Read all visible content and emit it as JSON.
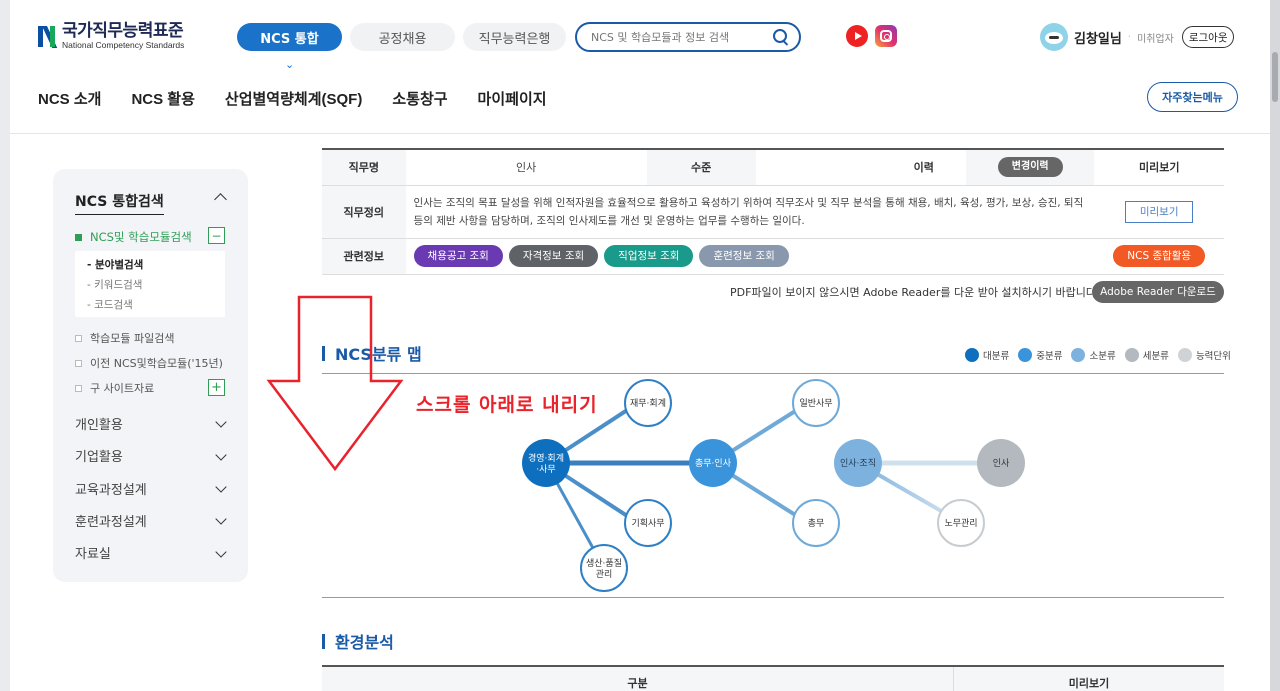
{
  "header": {
    "logo_ko": "국가직무능력표준",
    "logo_en": "National Competency Standards",
    "tabs": [
      "NCS 통합",
      "공정채용",
      "직무능력은행"
    ],
    "search_placeholder": "NCS 및 학습모듈과 정보 검색",
    "user_name": "김창일님",
    "user_role": "미취업자",
    "logout": "로그아웃",
    "nav": [
      "NCS 소개",
      "NCS 활용",
      "산업별역량체계(SQF)",
      "소통창구",
      "마이페이지"
    ],
    "faq": "자주찾는메뉴"
  },
  "sidebar": {
    "title": "NCS 통합검색",
    "active_item": "NCS및 학습모듈검색",
    "sub_items": [
      "- 분야별검색",
      "- 키워드검색",
      "- 코드검색"
    ],
    "items": [
      "학습모듈 파일검색",
      "이전 NCS및학습모듈('15년)",
      "구 사이트자료"
    ],
    "menus": [
      "개인활용",
      "기업활용",
      "교육과정설계",
      "훈련과정설계",
      "자료실"
    ]
  },
  "info": {
    "job_name_label": "직무명",
    "job_name": "인사",
    "level_label": "수준",
    "level": "",
    "history_label": "이력",
    "history_btn": "변경이력",
    "preview_label": "미리보기",
    "def_label": "직무정의",
    "definition": "인사는 조직의 목표 달성을 위해 인적자원을 효율적으로 활용하고 육성하기 위하여 직무조사 및 직무 분석을 통해 채용, 배치, 육성, 평가, 보상, 승진, 퇴직 등의 제반 사항을 담당하며, 조직의 인사제도를 개선 및 운영하는 업무를 수행하는 일이다.",
    "preview_btn": "미리보기",
    "related_label": "관련정보",
    "related_btns": [
      {
        "label": "채용공고 조회",
        "color": "#6a3ab2"
      },
      {
        "label": "자격정보 조회",
        "color": "#5f6368"
      },
      {
        "label": "직업정보 조회",
        "color": "#1a9a8a"
      },
      {
        "label": "훈련정보 조회",
        "color": "#8a98ad"
      }
    ],
    "ncs_btn": "NCS 종합활용"
  },
  "pdf_notice": "PDF파일이 보이지 않으시면 Adobe Reader를 다운 받아 설치하시기 바랍니다.",
  "pdf_btn": "Adobe Reader 다운로드",
  "map": {
    "title": "NCS분류 맵",
    "legend": [
      {
        "label": "대분류",
        "color": "#0f6fbf"
      },
      {
        "label": "중분류",
        "color": "#3a94dc"
      },
      {
        "label": "소분류",
        "color": "#7eb2de"
      },
      {
        "label": "세분류",
        "color": "#b3b9be"
      },
      {
        "label": "능력단위",
        "color": "#d0d3d6"
      }
    ],
    "nodes": {
      "root": "경영·회계·사무",
      "finance": "재무·회계",
      "planning": "기획사무",
      "production": "생산·품질관리",
      "general_hr": "총무·인사",
      "office": "일반사무",
      "general": "총무",
      "hr_org": "인사·조직",
      "hr": "인사",
      "labor": "노무관리"
    }
  },
  "overlay_text": "스크롤 아래로 내리기",
  "env": {
    "title": "환경분석",
    "col1": "구분",
    "col2": "미리보기"
  }
}
